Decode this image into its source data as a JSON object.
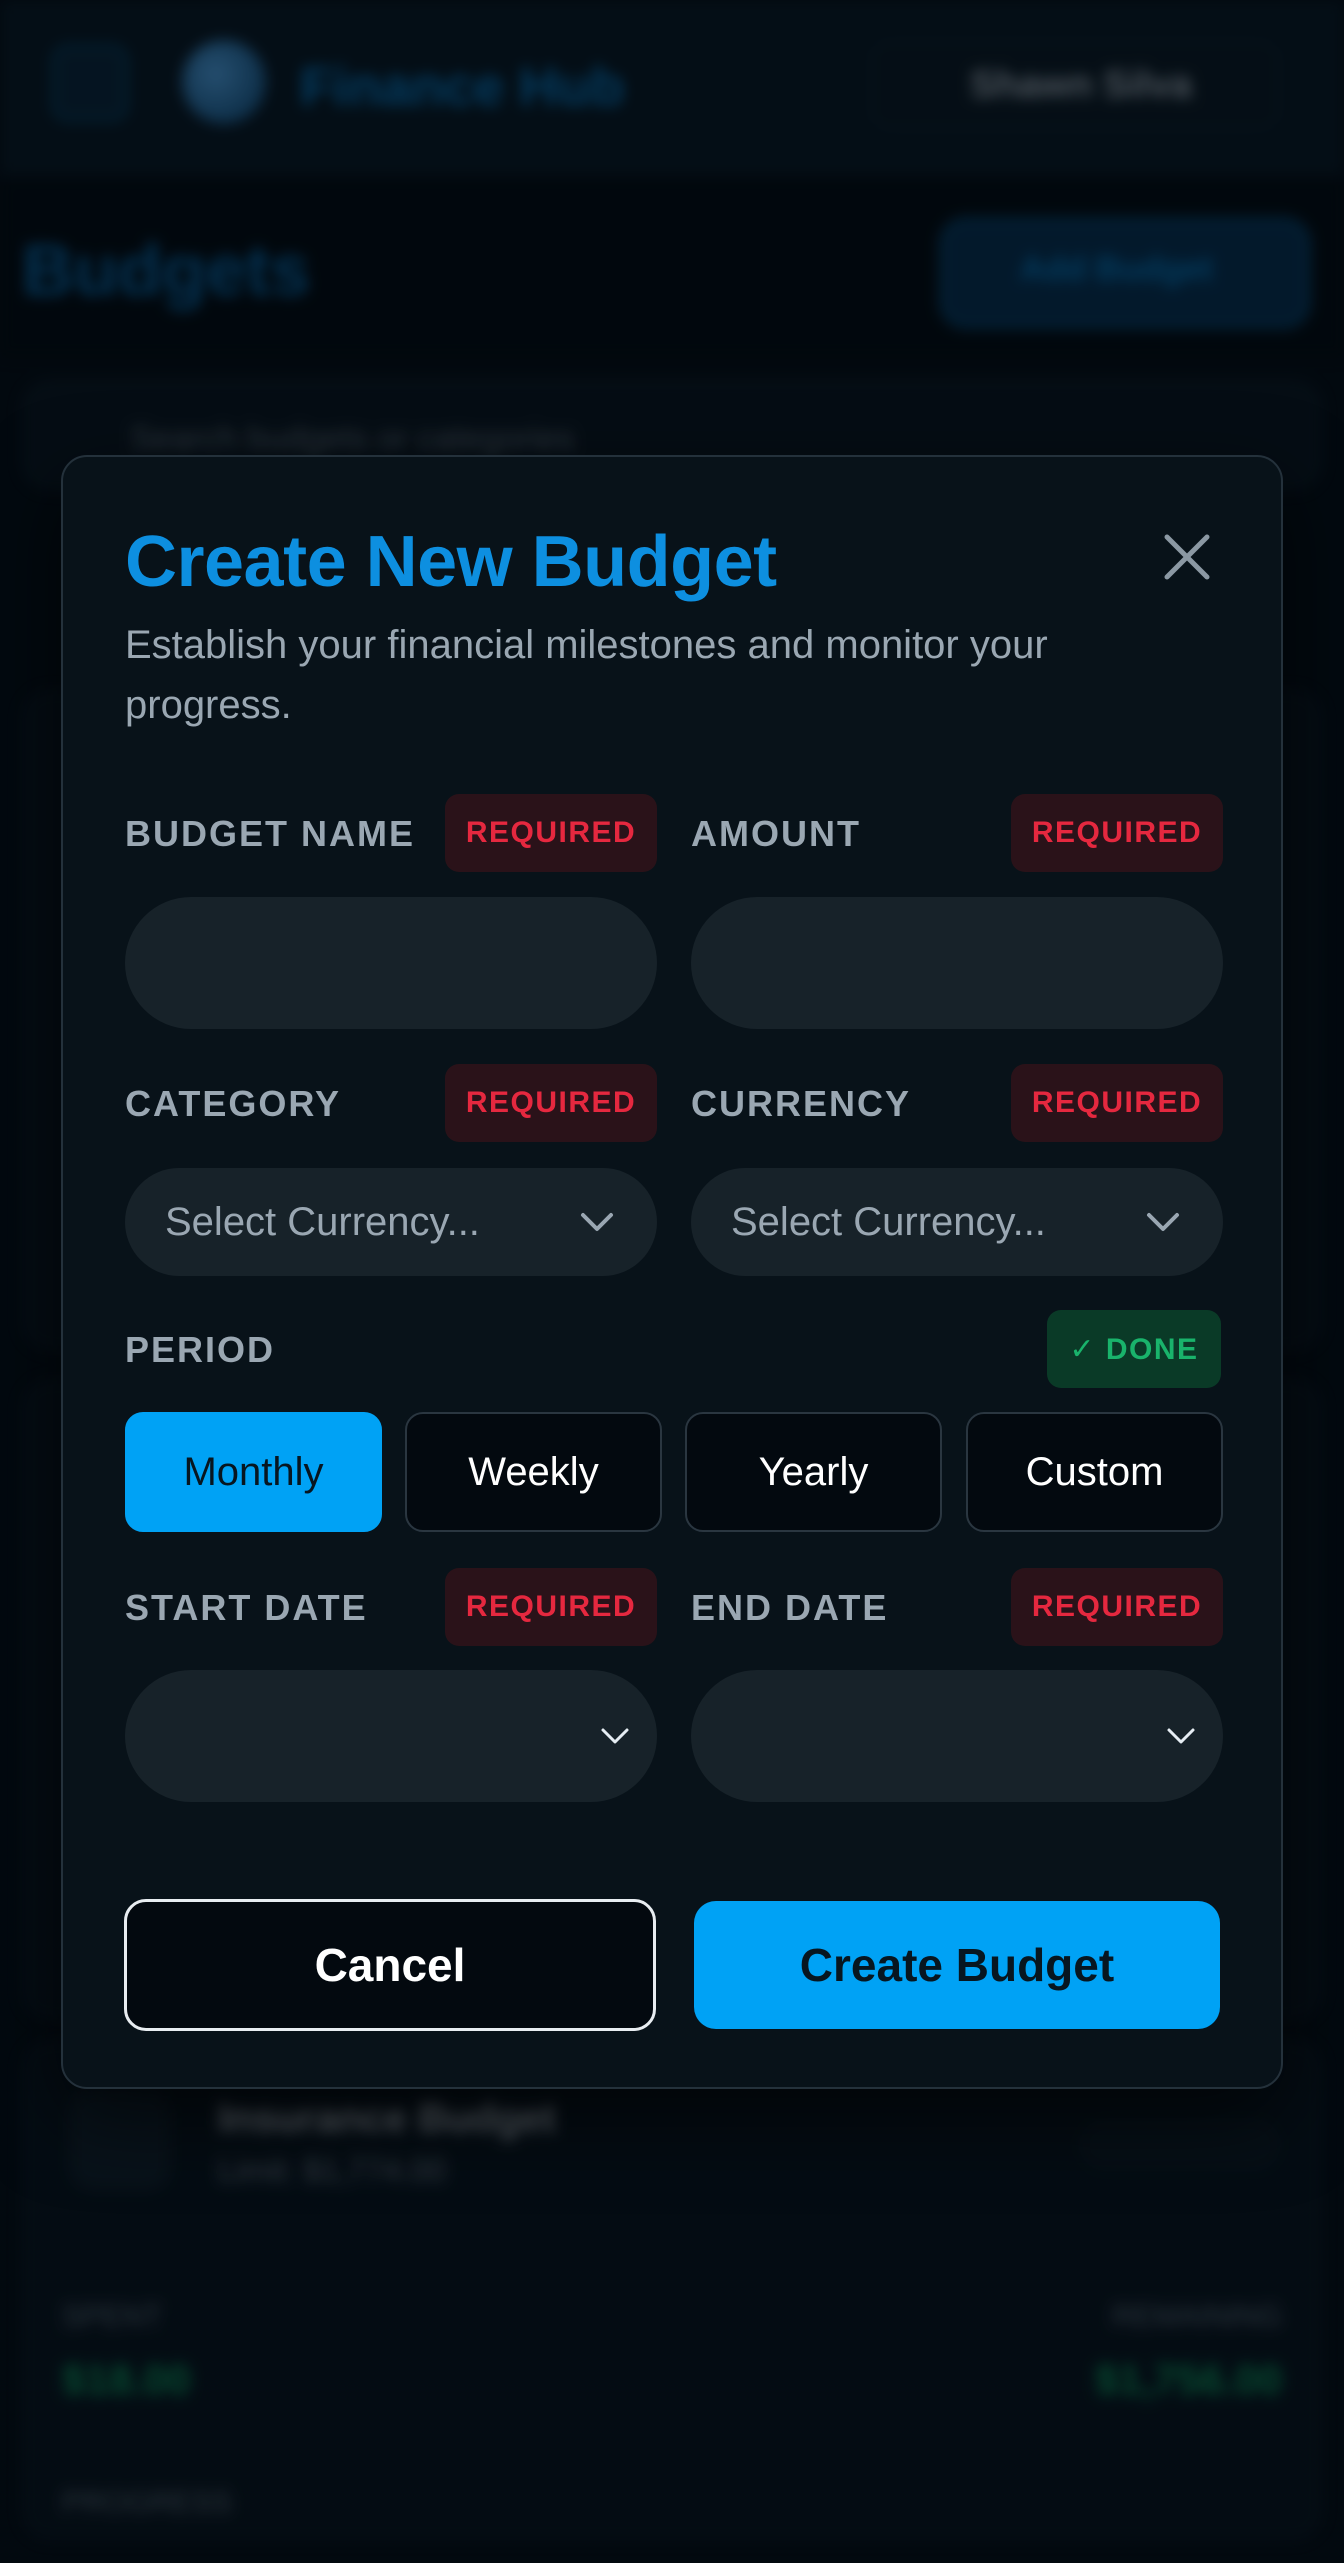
{
  "background": {
    "brand": "Finance Hub",
    "user_name": "Shawn Silva",
    "page_title": "Budgets",
    "new_button": "Add Budget",
    "search_placeholder": "Search budgets or categories",
    "card_title": "Insurance Budget",
    "card_sub": "Limit: $1,774.00",
    "spent_label": "SPENT",
    "spent_value": "$18.00",
    "remaining_label": "REMAINING",
    "remaining_value": "$1,756.00",
    "progress_label": "PROGRESS"
  },
  "modal": {
    "title": "Create New Budget",
    "subtitle": "Establish your financial milestones and monitor your progress.",
    "budget_name": {
      "label": "BUDGET NAME",
      "badge": "REQUIRED",
      "value": ""
    },
    "amount": {
      "label": "AMOUNT",
      "badge": "REQUIRED",
      "value": ""
    },
    "category": {
      "label": "CATEGORY",
      "badge": "REQUIRED",
      "selected": "Select Currency..."
    },
    "currency": {
      "label": "CURRENCY",
      "badge": "REQUIRED",
      "selected": "Select Currency..."
    },
    "period": {
      "label": "PERIOD",
      "badge": "✓ DONE",
      "options": [
        "Monthly",
        "Weekly",
        "Yearly",
        "Custom"
      ],
      "selected": "Monthly"
    },
    "start_date": {
      "label": "START DATE",
      "badge": "REQUIRED"
    },
    "end_date": {
      "label": "END DATE",
      "badge": "REQUIRED"
    },
    "cancel_label": "Cancel",
    "create_label": "Create Budget"
  },
  "colors": {
    "accent": "#00a2f5",
    "title": "#0d8fe0",
    "required": "#e5283f",
    "done": "#19b36b",
    "surface": "#081219",
    "field": "#172229"
  }
}
